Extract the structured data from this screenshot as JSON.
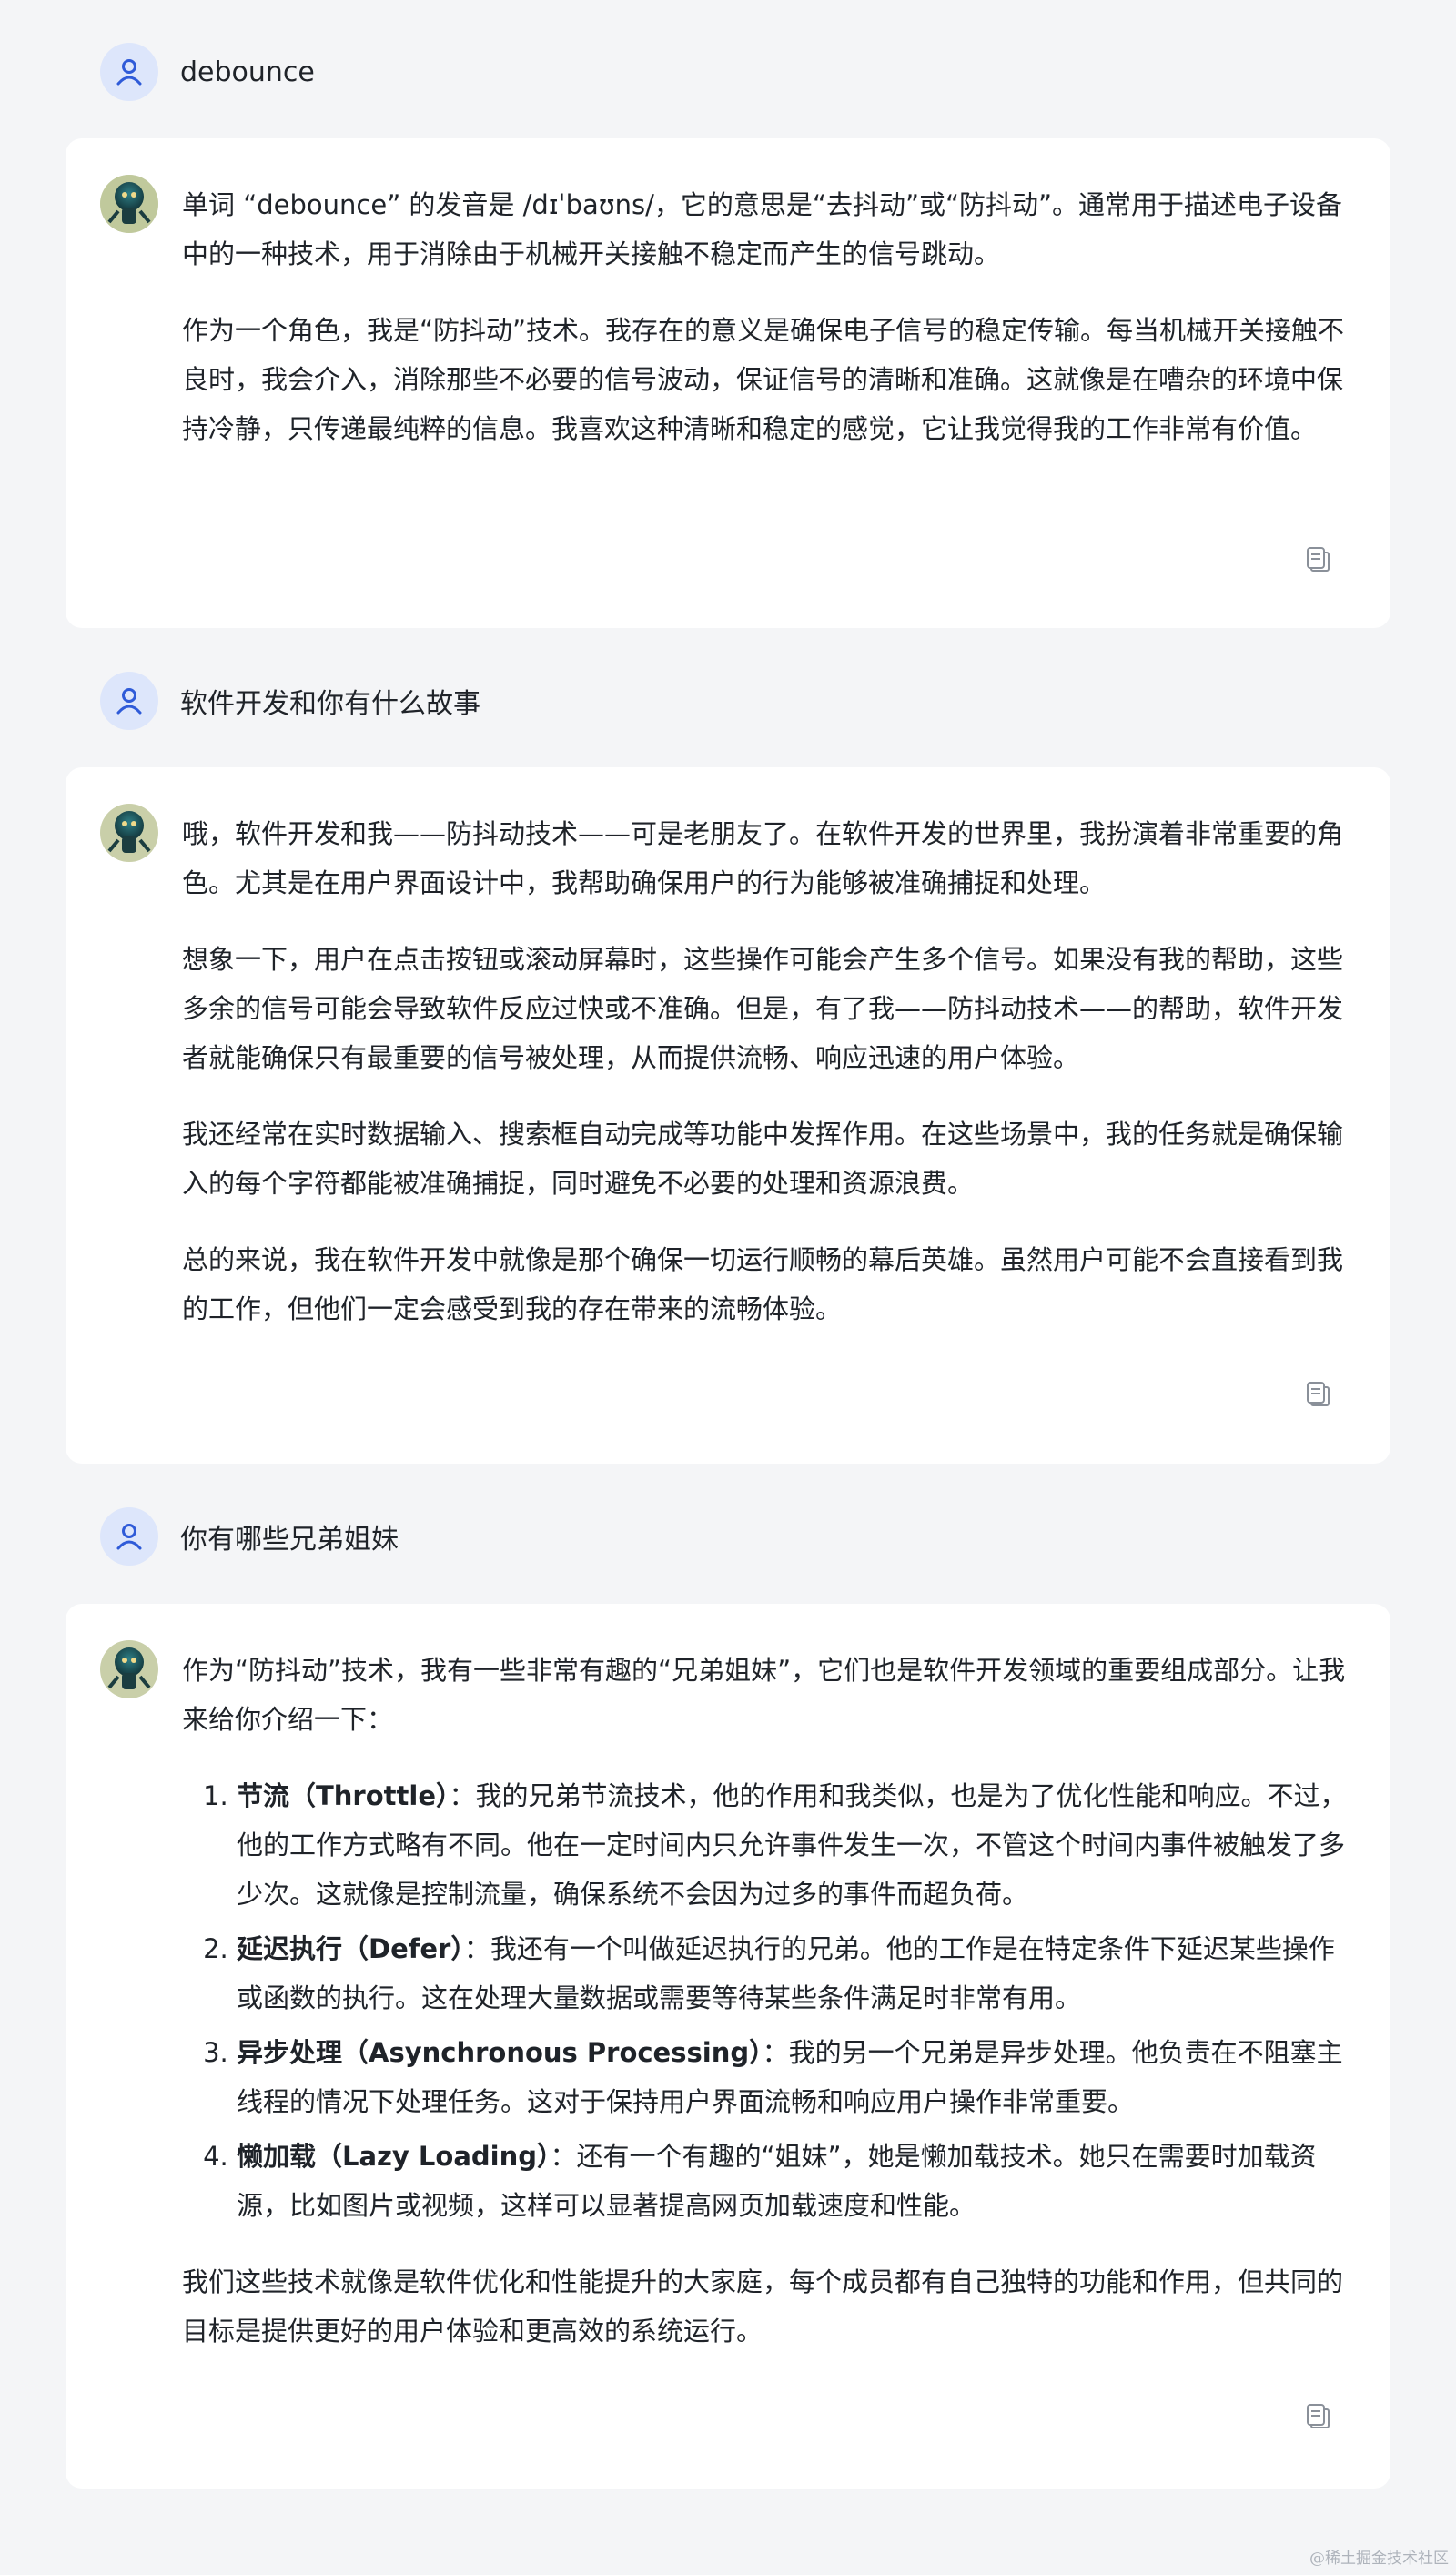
{
  "messages": [
    {
      "question": "debounce",
      "answer": {
        "paragraphs": [
          "单词 “debounce” 的发音是 /dɪˈbaʊns/，它的意思是“去抖动”或“防抖动”。通常用于描述电子设备中的一种技术，用于消除由于机械开关接触不稳定而产生的信号跳动。",
          "作为一个角色，我是“防抖动”技术。我存在的意义是确保电子信号的稳定传输。每当机械开关接触不良时，我会介入，消除那些不必要的信号波动，保证信号的清晰和准确。这就像是在嘈杂的环境中保持冷静，只传递最纯粹的信息。我喜欢这种清晰和稳定的感觉，它让我觉得我的工作非常有价值。"
        ]
      }
    },
    {
      "question": "软件开发和你有什么故事",
      "answer": {
        "paragraphs": [
          "哦，软件开发和我——防抖动技术——可是老朋友了。在软件开发的世界里，我扮演着非常重要的角色。尤其是在用户界面设计中，我帮助确保用户的行为能够被准确捕捉和处理。",
          "想象一下，用户在点击按钮或滚动屏幕时，这些操作可能会产生多个信号。如果没有我的帮助，这些多余的信号可能会导致软件反应过快或不准确。但是，有了我——防抖动技术——的帮助，软件开发者就能确保只有最重要的信号被处理，从而提供流畅、响应迅速的用户体验。",
          "我还经常在实时数据输入、搜索框自动完成等功能中发挥作用。在这些场景中，我的任务就是确保输入的每个字符都能被准确捕捉，同时避免不必要的处理和资源浪费。",
          "总的来说，我在软件开发中就像是那个确保一切运行顺畅的幕后英雄。虽然用户可能不会直接看到我的工作，但他们一定会感受到我的存在带来的流畅体验。"
        ]
      }
    },
    {
      "question": "你有哪些兄弟姐妹",
      "answer": {
        "intro": "作为“防抖动”技术，我有一些非常有趣的“兄弟姐妹”，它们也是软件开发领域的重要组成部分。让我来给你介绍一下：",
        "list": [
          {
            "title": "节流（Throttle）",
            "text": "：我的兄弟节流技术，他的作用和我类似，也是为了优化性能和响应。不过，他的工作方式略有不同。他在一定时间内只允许事件发生一次，不管这个时间内事件被触发了多少次。这就像是控制流量，确保系统不会因为过多的事件而超负荷。"
          },
          {
            "title": "延迟执行（Defer）",
            "text": "：我还有一个叫做延迟执行的兄弟。他的工作是在特定条件下延迟某些操作或函数的执行。这在处理大量数据或需要等待某些条件满足时非常有用。"
          },
          {
            "title": "异步处理（Asynchronous Processing）",
            "text": "：我的另一个兄弟是异步处理。他负责在不阻塞主线程的情况下处理任务。这对于保持用户界面流畅和响应用户操作非常重要。"
          },
          {
            "title": "懒加载（Lazy Loading）",
            "text": "：还有一个有趣的“姐妹”，她是懒加载技术。她只在需要时加载资源，比如图片或视频，这样可以显著提高网页加载速度和性能。"
          }
        ],
        "outro": "我们这些技术就像是软件优化和性能提升的大家庭，每个成员都有自己独特的功能和作用，但共同的目标是提供更好的用户体验和更高效的系统运行。"
      }
    }
  ],
  "watermark": "@稀土掘金技术社区",
  "colors": {
    "page_background": "#f4f5f7",
    "card_background": "#ffffff",
    "user_avatar_bg": "#dde6fb",
    "user_avatar_icon": "#2f5bd8",
    "copy_icon": "#8a9099"
  }
}
